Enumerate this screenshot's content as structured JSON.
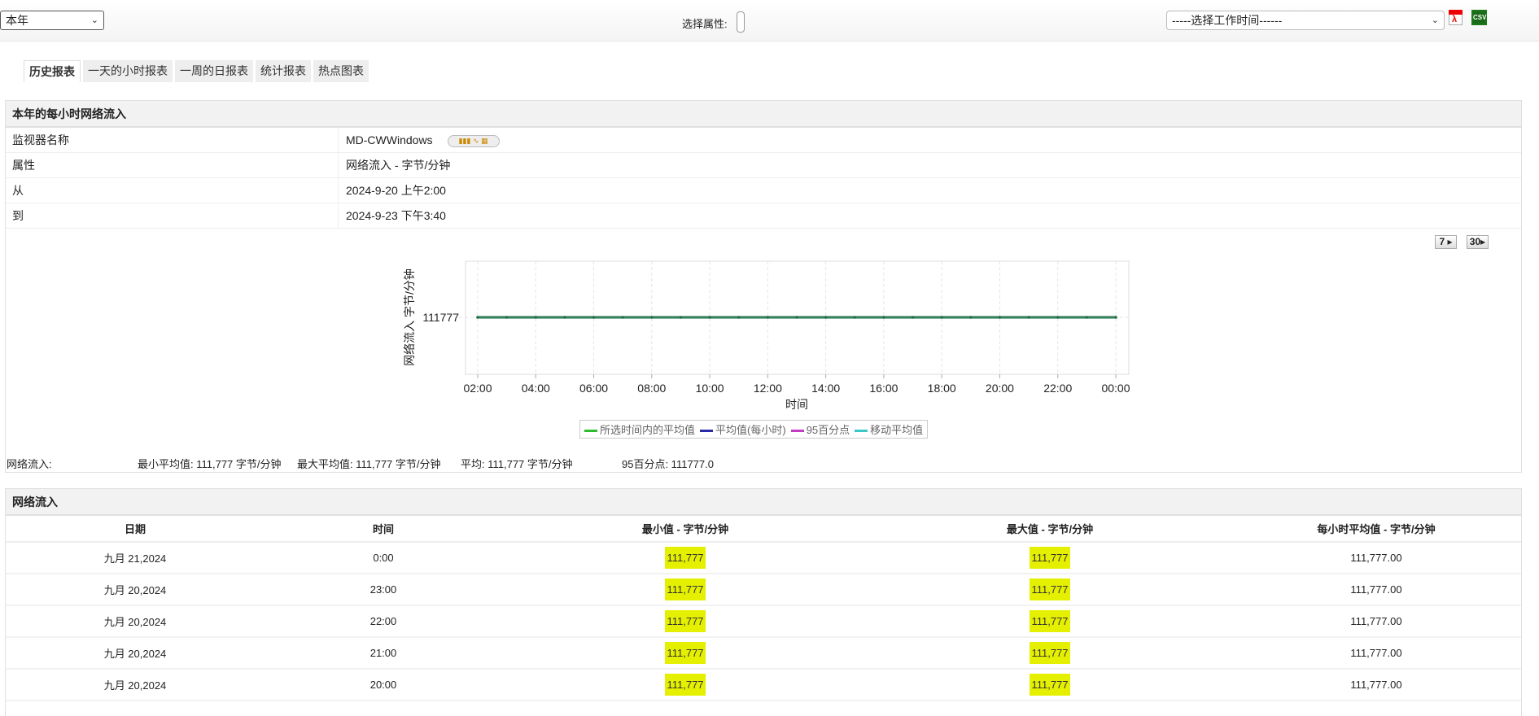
{
  "toolbar": {
    "period": "本年",
    "attribute_label": "选择属性:",
    "worktime": "-----选择工作时间------",
    "pdf_label": "PDF",
    "csv_label": "CSV"
  },
  "tabs": [
    "历史报表",
    "一天的小时报表",
    "一周的日报表",
    "统计报表",
    "热点图表"
  ],
  "summary": {
    "title": "本年的每小时网络流入",
    "rows": [
      {
        "label": "监视器名称",
        "value": "MD-CWWindows"
      },
      {
        "label": "属性",
        "value": "网络流入 - 字节/分钟"
      },
      {
        "label": "从",
        "value": "2024-9-20 上午2:00"
      },
      {
        "label": "到",
        "value": "2024-9-23 下午3:40"
      }
    ],
    "btn7": "7",
    "btn30": "30"
  },
  "chart_data": {
    "type": "line",
    "xlabel": "时间",
    "ylabel": "网络流入 字节/分钟",
    "x_ticks": [
      "02:00",
      "04:00",
      "06:00",
      "08:00",
      "10:00",
      "12:00",
      "14:00",
      "16:00",
      "18:00",
      "20:00",
      "22:00",
      "00:00"
    ],
    "y_ticks": [
      "111777"
    ],
    "x_hours": [
      2,
      3,
      4,
      5,
      6,
      7,
      8,
      9,
      10,
      11,
      12,
      13,
      14,
      15,
      16,
      17,
      18,
      19,
      20,
      21,
      22,
      23,
      24
    ],
    "series": [
      {
        "name": "所选时间内的平均值",
        "color": "#2ebd2e",
        "values": [
          111777,
          111777,
          111777,
          111777,
          111777,
          111777,
          111777,
          111777,
          111777,
          111777,
          111777,
          111777,
          111777,
          111777,
          111777,
          111777,
          111777,
          111777,
          111777,
          111777,
          111777,
          111777,
          111777
        ]
      }
    ],
    "legend": [
      {
        "name": "所选时间内的平均值",
        "color": "#2ebd2e"
      },
      {
        "name": "平均值(每小时)",
        "color": "#2a2aa8"
      },
      {
        "name": "95百分点",
        "color": "#c03cc0"
      },
      {
        "name": "移动平均值",
        "color": "#38c8c8"
      }
    ],
    "legend_position": "bottom"
  },
  "stats": {
    "label": "网络流入:",
    "min_avg": "最小平均值:  111,777  字节/分钟",
    "max_avg": "最大平均值:  111,777  字节/分钟",
    "avg": "平均:  111,777  字节/分钟",
    "p95": "95百分点:  111777.0"
  },
  "table": {
    "title": "网络流入",
    "headers": [
      "日期",
      "时间",
      "最小值 - 字节/分钟",
      "最大值 - 字节/分钟",
      "每小时平均值 - 字节/分钟"
    ],
    "rows": [
      [
        "九月 21,2024",
        "0:00",
        "111,777",
        "111,777",
        "111,777.00"
      ],
      [
        "九月 20,2024",
        "23:00",
        "111,777",
        "111,777",
        "111,777.00"
      ],
      [
        "九月 20,2024",
        "22:00",
        "111,777",
        "111,777",
        "111,777.00"
      ],
      [
        "九月 20,2024",
        "21:00",
        "111,777",
        "111,777",
        "111,777.00"
      ],
      [
        "九月 20,2024",
        "20:00",
        "111,777",
        "111,777",
        "111,777.00"
      ]
    ]
  }
}
